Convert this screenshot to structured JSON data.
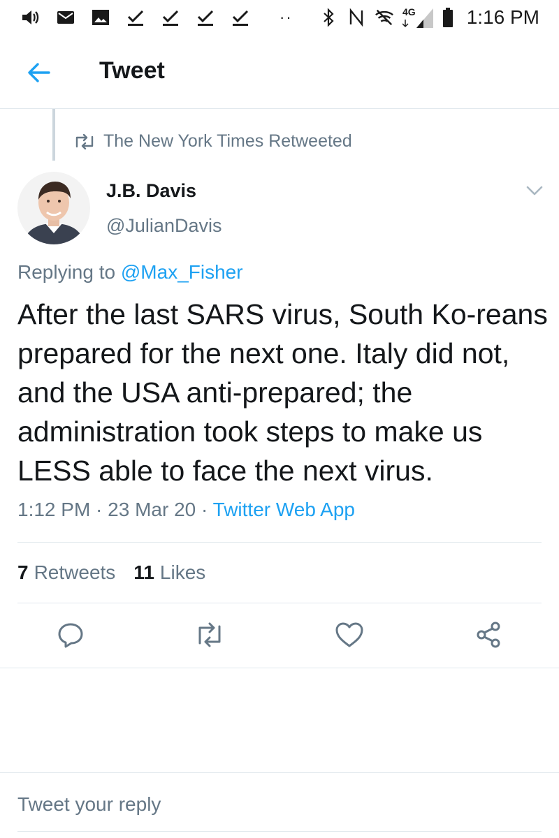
{
  "status_bar": {
    "network": "4G",
    "time": "1:16 PM",
    "dots": "··"
  },
  "header": {
    "title": "Tweet"
  },
  "retweet_context": {
    "text": "The New York Times Retweeted"
  },
  "author": {
    "name": "J.B. Davis",
    "handle": "@JulianDavis"
  },
  "replying": {
    "prefix": "Replying to ",
    "mention": "@Max_Fisher"
  },
  "tweet": {
    "text": "After the last SARS virus, South Ko-reans prepared for the next one. Italy did not, and the USA anti-prepared; the administration took steps to make us LESS able to face the next virus."
  },
  "meta": {
    "time": "1:12 PM",
    "sep1": " · ",
    "date": "23 Mar 20",
    "sep2": " · ",
    "source": "Twitter Web App"
  },
  "stats": {
    "retweets_count": "7",
    "retweets_label": "Retweets",
    "likes_count": "11",
    "likes_label": "Likes"
  },
  "reply": {
    "placeholder": "Tweet your reply"
  },
  "colors": {
    "accent": "#1da1f2",
    "secondary_text": "#657786",
    "divider": "#e1e8ed"
  }
}
